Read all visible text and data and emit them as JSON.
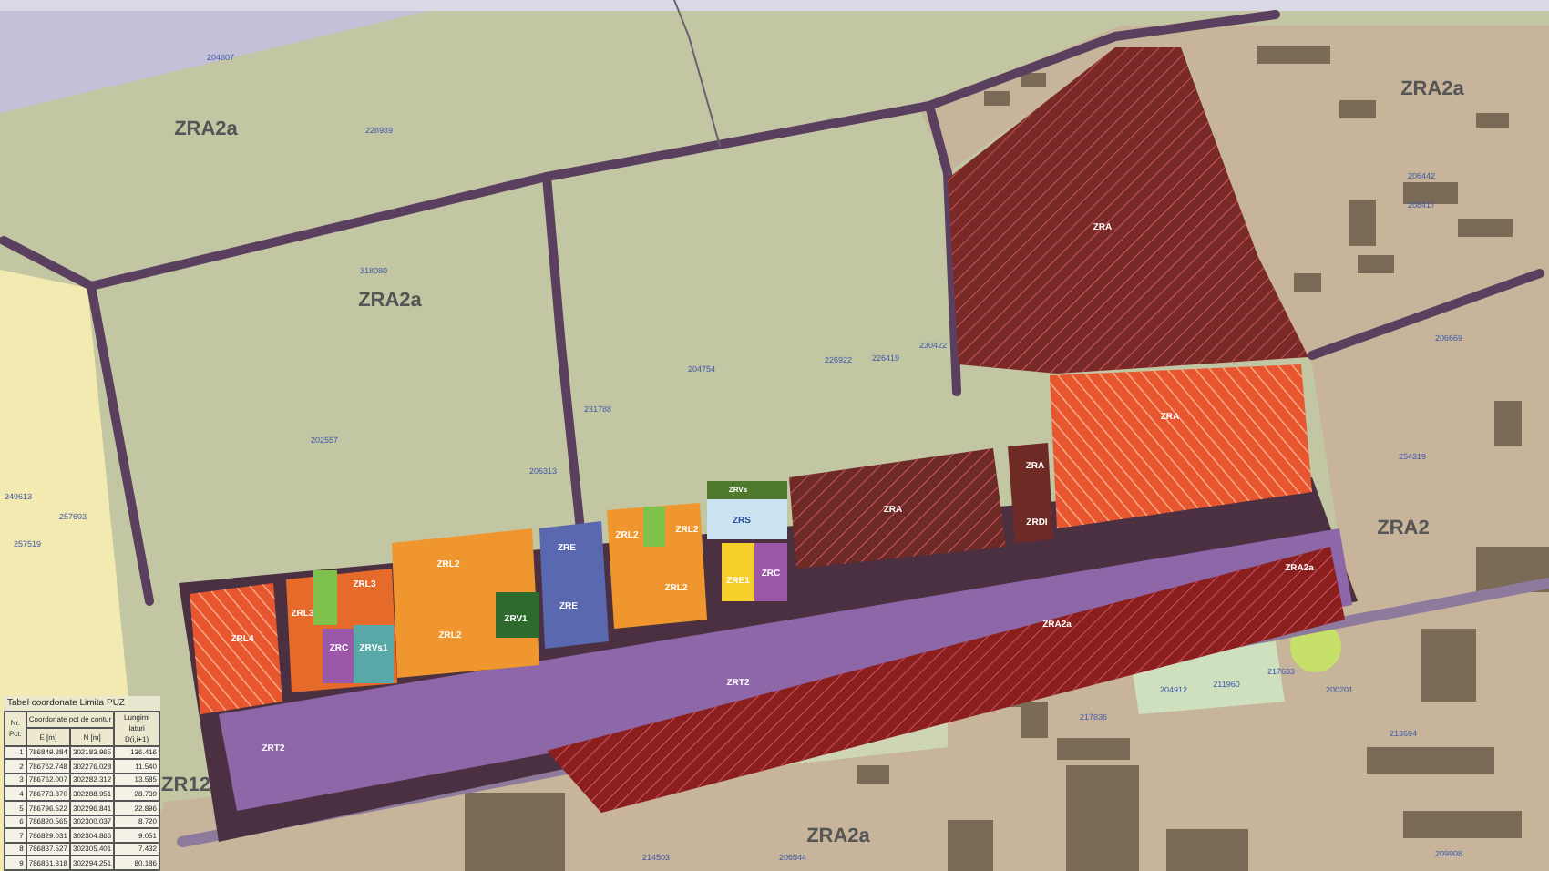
{
  "map": {
    "zone_labels": [
      "ZRA2a",
      "ZRA2a",
      "ZRA2a",
      "ZRA2a",
      "ZRA2",
      "ZR12",
      "ZRA",
      "ZRA",
      "ZRA",
      "ZRDI",
      "ZRA",
      "ZRA2a",
      "ZRA2a",
      "ZRT2",
      "ZRT2",
      "ZRL4",
      "ZRL3",
      "ZRL3",
      "ZRC",
      "ZRVs1",
      "ZRL2",
      "ZRL2",
      "ZRV1",
      "ZRE",
      "ZRE",
      "ZRL2",
      "ZRL2",
      "ZRL2",
      "ZRVs",
      "ZRS",
      "ZRE1",
      "ZRC"
    ],
    "parcel_numbers": [
      "204807",
      "228989",
      "318080",
      "202557",
      "204754",
      "231788",
      "226922",
      "226419",
      "230422",
      "206313",
      "249613",
      "257603",
      "257519",
      "206442",
      "208417",
      "206669",
      "254319",
      "204912",
      "211960",
      "217633",
      "200201",
      "213694",
      "217836",
      "214503",
      "206544",
      "209908"
    ]
  },
  "coordinates_table": {
    "title": "Tabel coordonate Limita PUZ",
    "point_header": "Nr. Pct.",
    "coordinates_header": "Coordonate pct de contur",
    "e_header": "E [m]",
    "n_header": "N [m]",
    "length_header": "Lungimi laturi D(i,i+1)",
    "rows": [
      {
        "point": "1",
        "e": "786849.384",
        "n": "302183.965",
        "length": "136.416"
      },
      {
        "point": "2",
        "e": "786762.748",
        "n": "302276.028",
        "length": "11.540"
      },
      {
        "point": "3",
        "e": "786762.007",
        "n": "302282.312",
        "length": "13.585"
      },
      {
        "point": "4",
        "e": "786773.870",
        "n": "302288.951",
        "length": "28.739"
      },
      {
        "point": "5",
        "e": "786796.522",
        "n": "302296.841",
        "length": "22.896"
      },
      {
        "point": "6",
        "e": "786820.565",
        "n": "302300.037",
        "length": "8.720"
      },
      {
        "point": "7",
        "e": "786829.031",
        "n": "302304.866",
        "length": "9.051"
      },
      {
        "point": "8",
        "e": "786837.527",
        "n": "302305.401",
        "length": "7.432"
      },
      {
        "point": "9",
        "e": "786861.318",
        "n": "302294.251",
        "length": "80.186"
      }
    ]
  }
}
